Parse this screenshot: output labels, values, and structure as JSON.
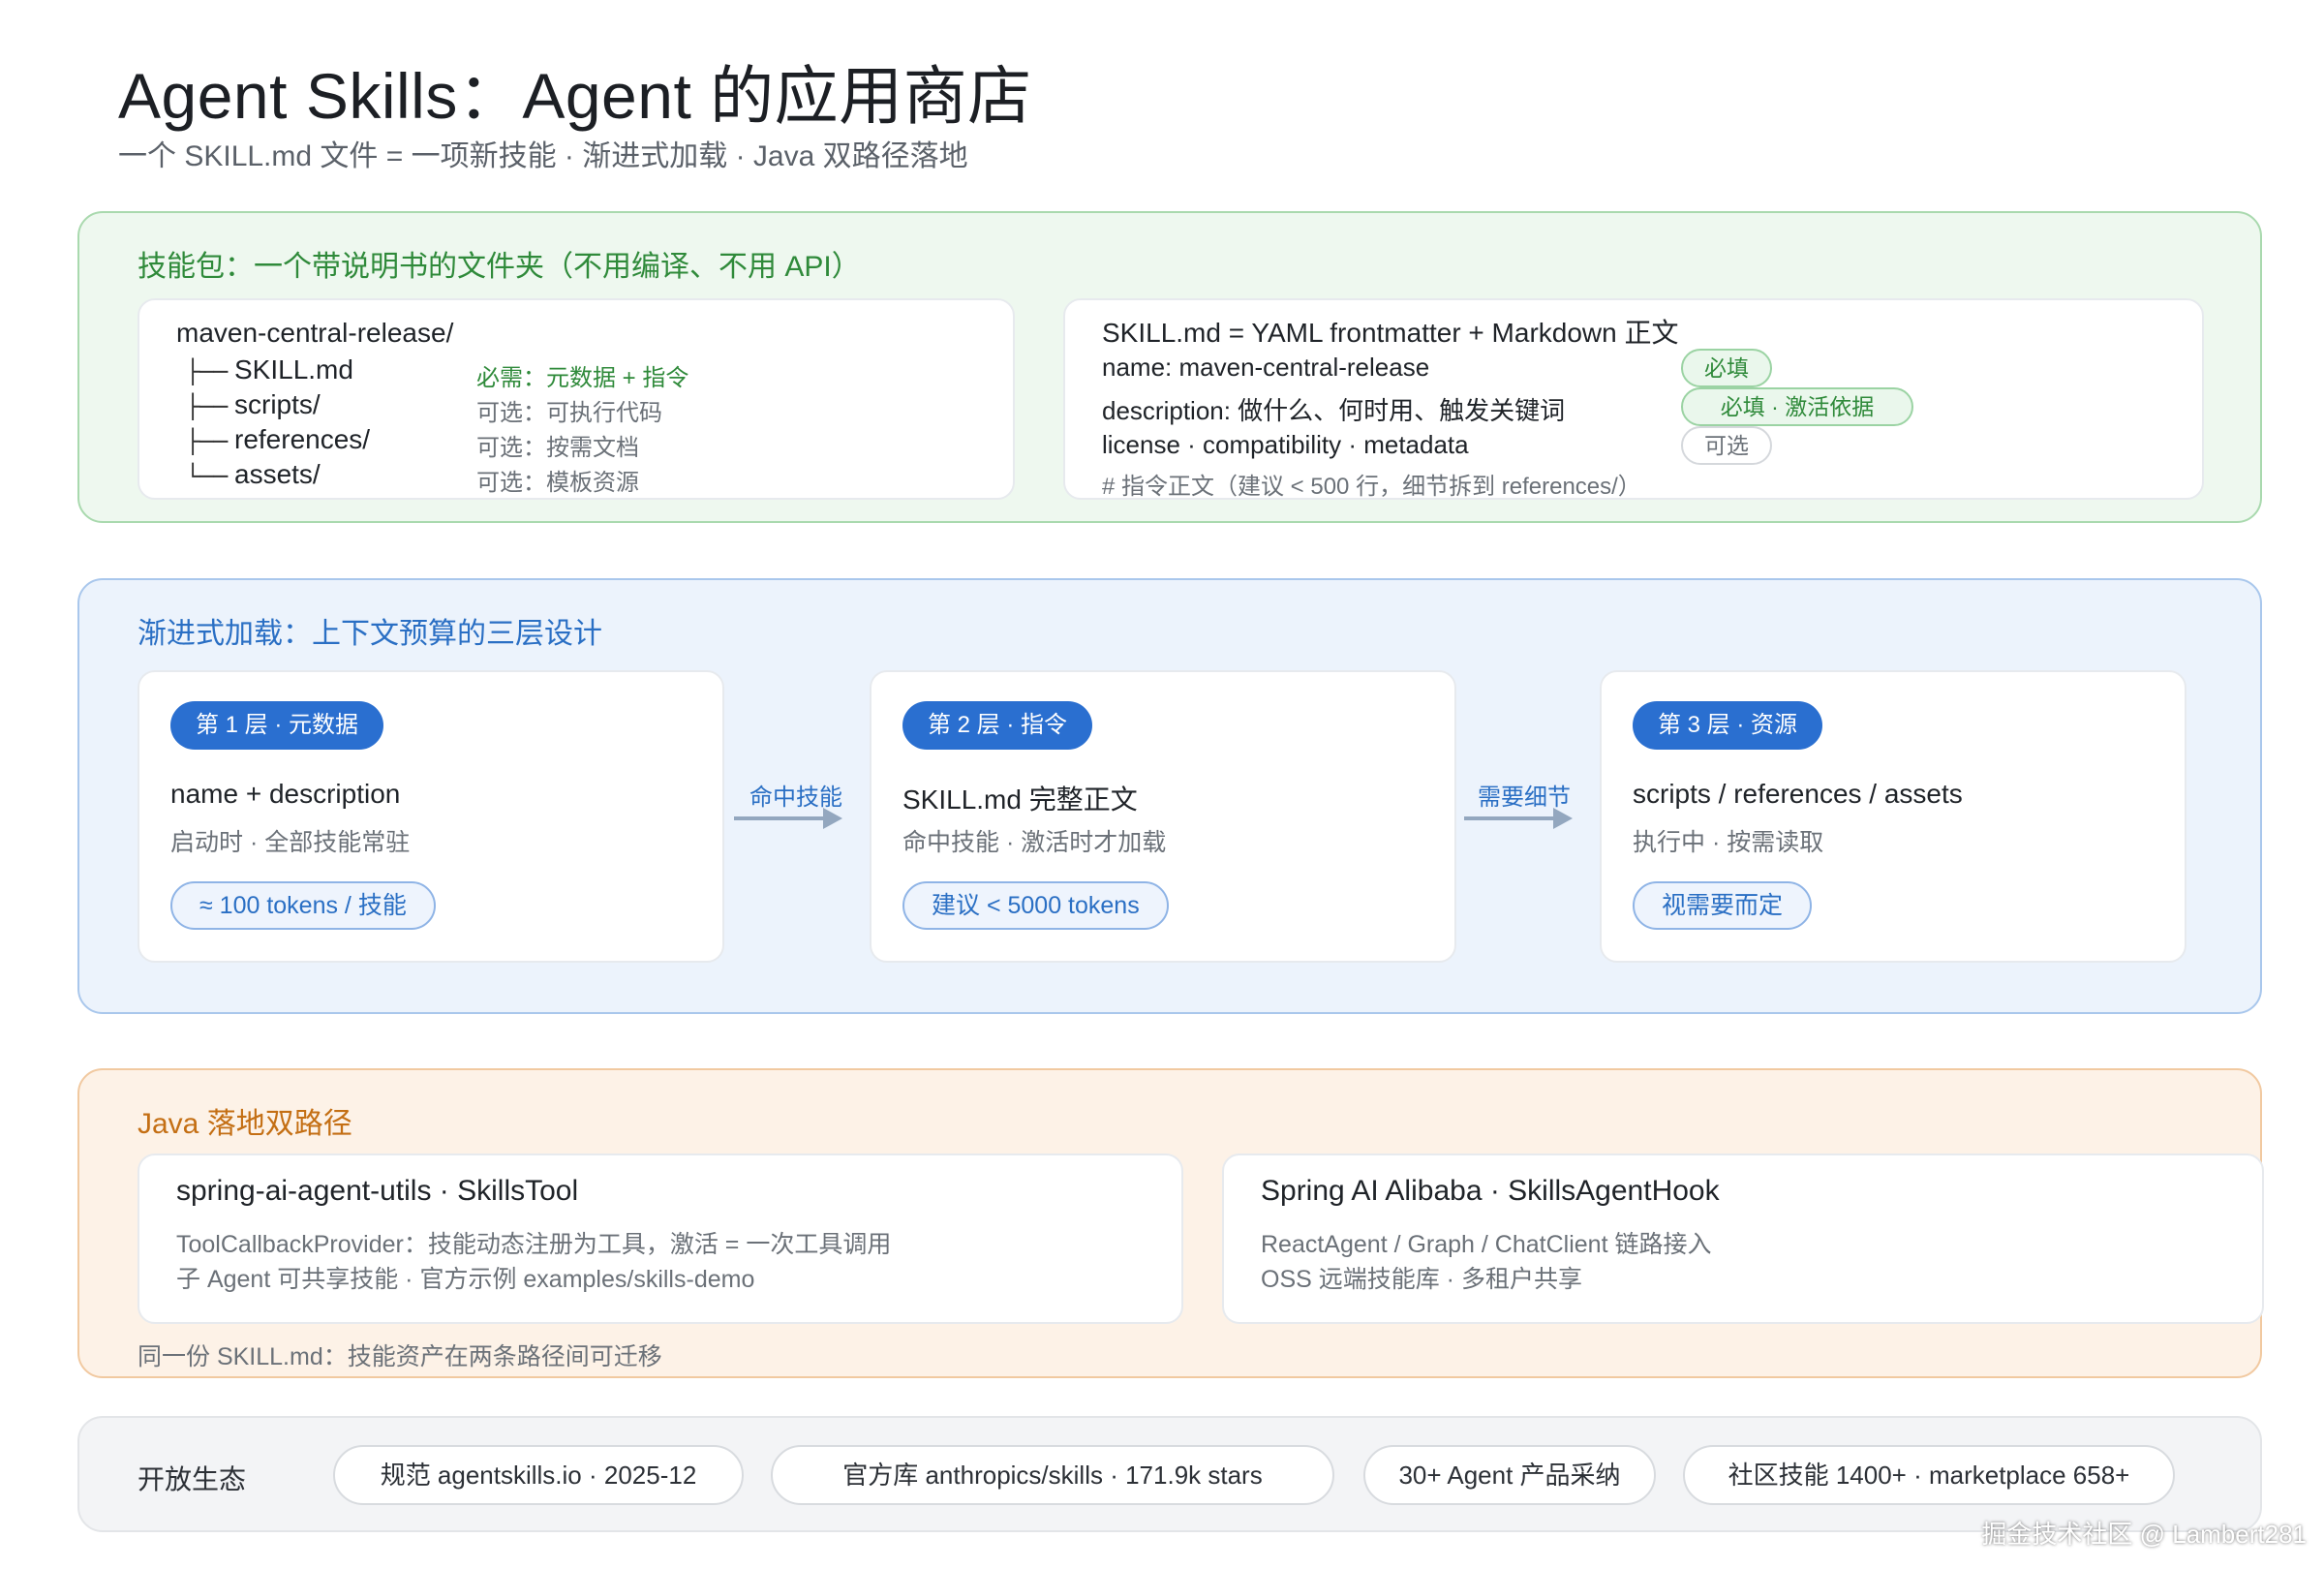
{
  "header": {
    "title": "Agent Skills：Agent 的应用商店",
    "subtitle": "一个 SKILL.md 文件 = 一项新技能 · 渐进式加载 · Java 双路径落地"
  },
  "package": {
    "title": "技能包：一个带说明书的文件夹（不用编译、不用 API）",
    "tree": {
      "root": "maven-central-release/",
      "items": [
        {
          "branch": "├──",
          "name": "SKILL.md",
          "desc": "必需：元数据 + 指令"
        },
        {
          "branch": "├──",
          "name": "scripts/",
          "desc": "可选：可执行代码"
        },
        {
          "branch": "├──",
          "name": "references/",
          "desc": "可选：按需文档"
        },
        {
          "branch": "└──",
          "name": "assets/",
          "desc": "可选：模板资源"
        }
      ]
    },
    "skill_md": {
      "title": "SKILL.md = YAML frontmatter + Markdown 正文",
      "rows": [
        {
          "text": "name: maven-central-release",
          "tag": "必填"
        },
        {
          "text": "description: 做什么、何时用、触发关键词",
          "tag": "必填 · 激活依据"
        },
        {
          "text": "license · compatibility · metadata",
          "tag": "可选"
        }
      ],
      "comment": "# 指令正文（建议 < 500 行，细节拆到 references/）"
    }
  },
  "loading": {
    "title": "渐进式加载：上下文预算的三层设计",
    "layers": [
      {
        "badge": "第 1 层 · 元数据",
        "main": "name + description",
        "sub": "启动时 · 全部技能常驻",
        "pill": "≈ 100 tokens / 技能"
      },
      {
        "badge": "第 2 层 · 指令",
        "main": "SKILL.md 完整正文",
        "sub": "命中技能 · 激活时才加载",
        "pill": "建议 < 5000 tokens"
      },
      {
        "badge": "第 3 层 · 资源",
        "main": "scripts / references / assets",
        "sub": "执行中 · 按需读取",
        "pill": "视需要而定"
      }
    ],
    "arrows": [
      "命中技能",
      "需要细节"
    ]
  },
  "java": {
    "title": "Java 落地双路径",
    "paths": [
      {
        "title": "spring-ai-agent-utils · SkillsTool",
        "lines": [
          "ToolCallbackProvider：技能动态注册为工具，激活 = 一次工具调用",
          "子 Agent 可共享技能 · 官方示例 examples/skills-demo"
        ]
      },
      {
        "title": "Spring AI Alibaba · SkillsAgentHook",
        "lines": [
          "ReactAgent / Graph / ChatClient 链路接入",
          "OSS 远端技能库 · 多租户共享"
        ]
      }
    ],
    "footer": "同一份 SKILL.md：技能资产在两条路径间可迁移"
  },
  "ecosystem": {
    "label": "开放生态",
    "pills": [
      "规范 agentskills.io · 2025-12",
      "官方库 anthropics/skills · 171.9k stars",
      "30+ Agent 产品采纳",
      "社区技能 1400+ · marketplace 658+"
    ]
  },
  "watermark": "掘金技术社区 @ Lambert281",
  "colors": {
    "green": "#2f8a3a",
    "blue": "#2a6fd0",
    "orange": "#c46f14"
  }
}
